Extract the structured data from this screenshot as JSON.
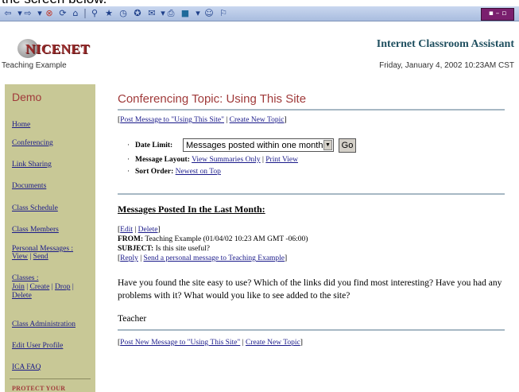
{
  "browser": {
    "caption": "the screen below.",
    "toolbar_icons": [
      "back-icon",
      "forward-icon",
      "stop-icon",
      "refresh-icon",
      "home-icon",
      "search-icon",
      "favorites-icon",
      "history-icon",
      "mail-icon",
      "print-icon",
      "edit-icon",
      "discuss-icon",
      "messenger-icon"
    ]
  },
  "header": {
    "logo": "NICENET",
    "class_name": "Teaching Example",
    "app_title": "Internet Classroom Assistant",
    "date": "Friday, January 4, 2002 10:23AM CST"
  },
  "sidebar": {
    "title": "Demo",
    "items": [
      {
        "label": "Home"
      },
      {
        "label": "Conferencing"
      },
      {
        "label": "Link Sharing"
      },
      {
        "label": "Documents"
      },
      {
        "label": "Class Schedule"
      },
      {
        "label": "Class Members"
      }
    ],
    "personal_messages": {
      "label": "Personal Messages :",
      "view": "View",
      "send": "Send"
    },
    "classes": {
      "label": "Classes :",
      "join": "Join",
      "create": "Create",
      "drop": "Drop",
      "delete": "Delete"
    },
    "class_admin": "Class Administration",
    "edit_profile": "Edit User Profile",
    "faq": "ICA FAQ",
    "protect": "PROTECT YOUR"
  },
  "main": {
    "title": "Conferencing Topic: Using This Site",
    "top_links": {
      "post": "Post Message to \"Using This Site\"",
      "create": "Create New Topic"
    },
    "date_limit_label": "Date Limit:",
    "date_limit_value": "Messages posted within one month",
    "go_label": "Go",
    "message_layout_label": "Message Layout:",
    "layout_summaries": "View Summaries Only",
    "layout_print": "Print View",
    "sort_order_label": "Sort Order:",
    "sort_value": "Newest on Top",
    "messages_heading": "Messages Posted In the Last Month:",
    "message": {
      "edit": "Edit",
      "delete": "Delete",
      "from_label": "FROM:",
      "from_value": "Teaching Example  (01/04/02 10:23 AM GMT -06:00)",
      "subject_label": "SUBJECT:",
      "subject_value": "Is this site useful?",
      "reply": "Reply",
      "send_personal": "Send a personal message to Teaching Example",
      "body": "Have you found the site easy to use? Which of the links did you find most interesting? Have you had any problems with it? What would you like to see added to the site?",
      "signature": "Teacher"
    },
    "bottom_links": {
      "post": "Post New Message to \"Using This Site\"",
      "create": "Create New Topic"
    }
  }
}
